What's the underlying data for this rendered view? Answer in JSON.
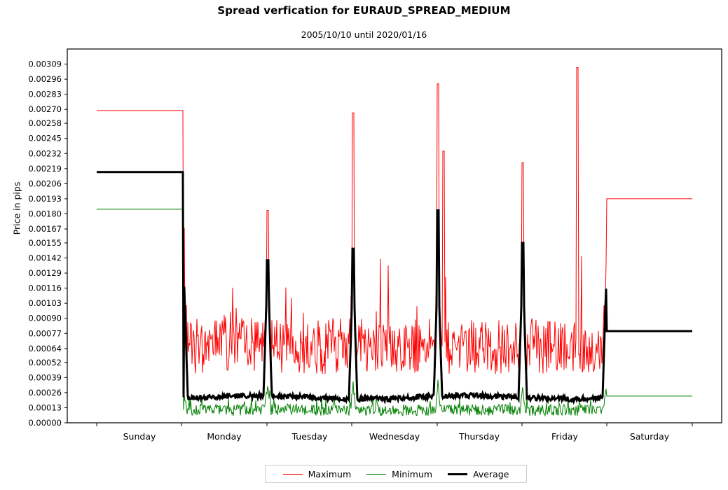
{
  "chart_data": {
    "type": "line",
    "title": "Spread verfication for EURAUD_SPREAD_MEDIUM",
    "subtitle": "2005/10/10 until 2020/01/16",
    "xlabel": "",
    "ylabel": "Price in pips",
    "grid": false,
    "legend_position": "below-center",
    "ylim": [
      0.0,
      0.00322
    ],
    "ytick_labels": [
      "0.00000",
      "0.00013",
      "0.00026",
      "0.00039",
      "0.00052",
      "0.00064",
      "0.00077",
      "0.00090",
      "0.00103",
      "0.00116",
      "0.00129",
      "0.00142",
      "0.00155",
      "0.00167",
      "0.00180",
      "0.00193",
      "0.00206",
      "0.00219",
      "0.00232",
      "0.00245",
      "0.00258",
      "0.00270",
      "0.00283",
      "0.00296",
      "0.00309"
    ],
    "ytick_values": [
      0.0,
      0.00013,
      0.00026,
      0.00039,
      0.00052,
      0.00064,
      0.00077,
      0.0009,
      0.00103,
      0.00116,
      0.00129,
      0.00142,
      0.00155,
      0.00167,
      0.0018,
      0.00193,
      0.00206,
      0.00219,
      0.00232,
      0.00245,
      0.00258,
      0.0027,
      0.00283,
      0.00296,
      0.00309
    ],
    "categories": [
      "Sunday",
      "Monday",
      "Tuesday",
      "Wednesday",
      "Thursday",
      "Friday",
      "Saturday"
    ],
    "xtick_centers": [
      199,
      320,
      442,
      563,
      684,
      806,
      927
    ],
    "xtick_edges": [
      138,
      259,
      381,
      502,
      624,
      745,
      866,
      988
    ],
    "series": [
      {
        "name": "Maximum",
        "color": "#ff0000",
        "linewidth": 1,
        "plateau_weekend_start": 0.00269,
        "plateau_weekend_end": 0.00193,
        "intraday_mean": 0.00066,
        "intraday_low": 0.00048,
        "intraday_high": 0.00092,
        "boundary_spikes": [
          {
            "x": 262,
            "value": 0.00168
          },
          {
            "x": 382,
            "value": 0.00183
          },
          {
            "x": 504,
            "value": 0.00267
          },
          {
            "x": 625,
            "value": 0.00292
          },
          {
            "x": 633,
            "value": 0.00234
          },
          {
            "x": 746,
            "value": 0.00224
          },
          {
            "x": 824,
            "value": 0.00306
          }
        ]
      },
      {
        "name": "Minimum",
        "color": "#008000",
        "linewidth": 1,
        "plateau_weekend_start": 0.00184,
        "plateau_weekend_end": 0.00023,
        "intraday_mean": 0.00011,
        "intraday_low": 7e-05,
        "intraday_high": 0.00017
      },
      {
        "name": "Average",
        "color": "#000000",
        "linewidth": 3,
        "plateau_weekend_start": 0.00216,
        "plateau_weekend_end": 0.00079,
        "intraday_mean": 0.00022,
        "intraday_low": 0.00019,
        "intraday_high": 0.00027,
        "boundary_spikes": [
          {
            "x": 382,
            "value": 0.0014
          },
          {
            "x": 504,
            "value": 0.0015
          },
          {
            "x": 625,
            "value": 0.00183
          },
          {
            "x": 746,
            "value": 0.00155
          }
        ]
      }
    ]
  },
  "legend": {
    "items": [
      {
        "label": "Maximum",
        "color": "#ff0000"
      },
      {
        "label": "Minimum",
        "color": "#008000"
      },
      {
        "label": "Average",
        "color": "#000000"
      }
    ]
  },
  "axes": {
    "plot_left": 96,
    "plot_right": 1030,
    "plot_top": 70,
    "plot_bottom": 604
  }
}
